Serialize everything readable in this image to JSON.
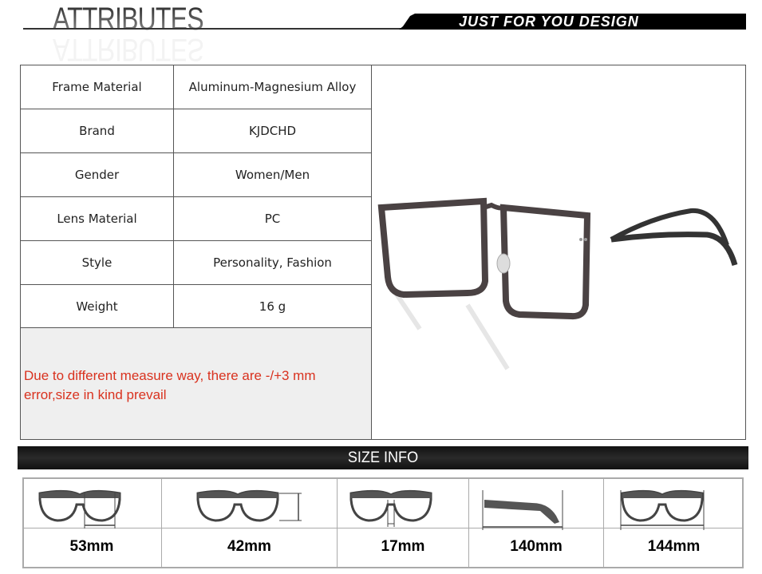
{
  "header": {
    "title": "ATTRIBUTES",
    "tagline": "JUST FOR YOU DESIGN"
  },
  "attributes": [
    {
      "key": "Frame Material",
      "value": "Aluminum-Magnesium Alloy"
    },
    {
      "key": "Brand",
      "value": "KJDCHD"
    },
    {
      "key": "Gender",
      "value": "Women/Men"
    },
    {
      "key": "Lens Material",
      "value": "PC"
    },
    {
      "key": "Style",
      "value": "Personality, Fashion"
    },
    {
      "key": "Weight",
      "value": "16 g"
    }
  ],
  "note": "Due to different measure way, there are -/+3 mm error,size in kind prevail",
  "note_color": "#d9321f",
  "size_info": {
    "title": "SIZE INFO",
    "items": [
      {
        "icon": "lens-width-icon",
        "label": "53mm"
      },
      {
        "icon": "lens-height-icon",
        "label": "42mm"
      },
      {
        "icon": "bridge-width-icon",
        "label": "17mm"
      },
      {
        "icon": "temple-length-icon",
        "label": "140mm"
      },
      {
        "icon": "frame-width-icon",
        "label": "144mm"
      }
    ]
  }
}
